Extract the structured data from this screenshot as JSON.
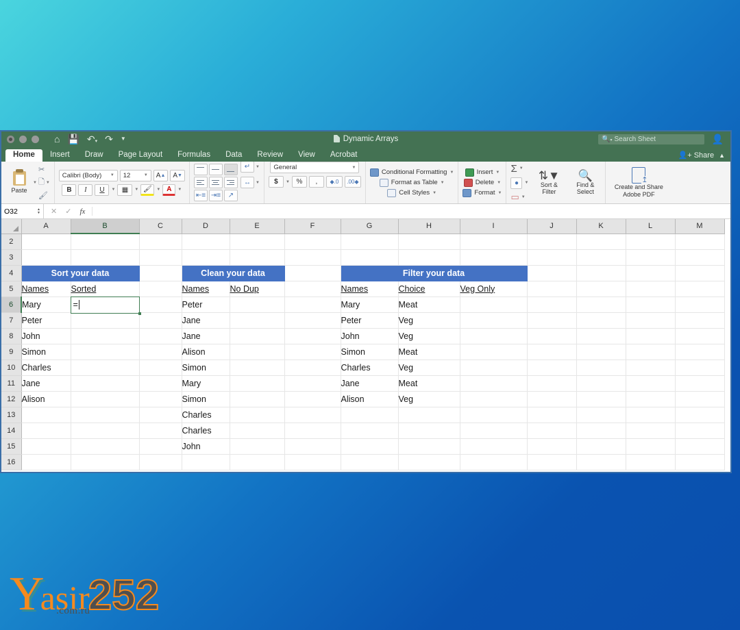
{
  "window": {
    "title": "Dynamic Arrays",
    "traffic_lights": [
      "close",
      "minimize",
      "maximize"
    ],
    "quick_access": [
      "home-icon",
      "save-icon",
      "undo-icon",
      "redo-icon",
      "customize-icon"
    ],
    "search_placeholder": "Search Sheet",
    "share_label": "Share"
  },
  "tabs": [
    {
      "label": "Home",
      "active": true
    },
    {
      "label": "Insert",
      "active": false
    },
    {
      "label": "Draw",
      "active": false
    },
    {
      "label": "Page Layout",
      "active": false
    },
    {
      "label": "Formulas",
      "active": false
    },
    {
      "label": "Data",
      "active": false
    },
    {
      "label": "Review",
      "active": false
    },
    {
      "label": "View",
      "active": false
    },
    {
      "label": "Acrobat",
      "active": false
    }
  ],
  "ribbon": {
    "clipboard": {
      "paste_label": "Paste",
      "cut_icon": "scissors-icon",
      "copy_icon": "copy-icon",
      "format_painter_icon": "paintbrush-icon"
    },
    "font": {
      "family": "Calibri (Body)",
      "size": "12",
      "grow_label": "A",
      "shrink_label": "A",
      "bold": "B",
      "italic": "I",
      "underline": "U",
      "borders_icon": "borders-icon",
      "fill_color_icon": "fill-color-icon",
      "font_color_icon": "font-color-icon"
    },
    "alignment": {
      "top_align": "align-top-icon",
      "middle_align": "align-middle-icon",
      "bottom_align": "align-bottom-icon",
      "align_left": "align-left-icon",
      "align_center": "align-center-icon",
      "align_right": "align-right-icon",
      "decrease_indent": "decrease-indent-icon",
      "increase_indent": "increase-indent-icon",
      "orientation": "orientation-icon",
      "wrap_text": "wrap-text-icon",
      "merge_center": "merge-center-icon"
    },
    "number": {
      "format": "General",
      "currency": "$",
      "percent": "%",
      "comma": ",",
      "increase_decimal": "increase-decimal-icon",
      "decrease_decimal": "decrease-decimal-icon"
    },
    "styles": [
      {
        "label": "Conditional Formatting",
        "icon": "conditional-formatting-icon"
      },
      {
        "label": "Format as Table",
        "icon": "format-as-table-icon"
      },
      {
        "label": "Cell Styles",
        "icon": "cell-styles-icon"
      }
    ],
    "cells": [
      {
        "label": "Insert",
        "icon": "insert-cells-icon"
      },
      {
        "label": "Delete",
        "icon": "delete-cells-icon"
      },
      {
        "label": "Format",
        "icon": "format-cells-icon"
      }
    ],
    "editing": {
      "autosum_icon": "sigma-icon",
      "fill_icon": "fill-icon",
      "clear_icon": "eraser-icon",
      "sort_filter_label": "Sort &\nFilter",
      "sort_filter_line1": "Sort &",
      "sort_filter_line2": "Filter",
      "find_select_line1": "Find &",
      "find_select_line2": "Select"
    },
    "acrobat": {
      "line1": "Create and Share",
      "line2": "Adobe PDF"
    }
  },
  "formula_bar": {
    "name_box": "O32",
    "cancel_icon": "cancel-icon",
    "confirm_icon": "confirm-icon",
    "function_icon": "fx",
    "value": ""
  },
  "grid": {
    "columns": [
      "A",
      "B",
      "C",
      "D",
      "E",
      "F",
      "G",
      "H",
      "I",
      "J",
      "K",
      "L",
      "M"
    ],
    "selected_column": "B",
    "rows": [
      "2",
      "3",
      "4",
      "5",
      "6",
      "7",
      "8",
      "9",
      "10",
      "11",
      "12",
      "13",
      "14",
      "15",
      "16"
    ],
    "selected_row": "6",
    "active_cell": "B6",
    "active_cell_value": "=",
    "banner_color": "#4472c4",
    "banners": [
      {
        "text": "Sort your data",
        "row": "4",
        "start_col": "A",
        "span": 2
      },
      {
        "text": "Clean your data",
        "row": "4",
        "start_col": "D",
        "span": 2
      },
      {
        "text": "Filter your data",
        "row": "4",
        "start_col": "G",
        "span": 3
      }
    ],
    "sections": {
      "sort": {
        "title": "Sort your data",
        "headers": [
          "Names",
          "Sorted"
        ],
        "names": [
          "Mary",
          "Peter",
          "John",
          "Simon",
          "Charles",
          "Jane",
          "Alison"
        ],
        "sorted": []
      },
      "clean": {
        "title": "Clean your data",
        "headers": [
          "Names",
          "No Dup"
        ],
        "names": [
          "Peter",
          "Jane",
          "Jane",
          "Alison",
          "Simon",
          "Mary",
          "Simon",
          "Charles",
          "Charles",
          "John"
        ],
        "no_dup": []
      },
      "filter": {
        "title": "Filter your data",
        "headers": [
          "Names",
          "Choice",
          "Veg Only"
        ],
        "names": [
          "Mary",
          "Peter",
          "John",
          "Simon",
          "Charles",
          "Jane",
          "Alison"
        ],
        "choices": [
          "Meat",
          "Veg",
          "Veg",
          "Meat",
          "Veg",
          "Meat",
          "Veg"
        ],
        "veg_only": []
      }
    }
  },
  "watermark": {
    "letter": "Y",
    "word": "asir",
    "domain": ".com.ru",
    "number": "252"
  }
}
